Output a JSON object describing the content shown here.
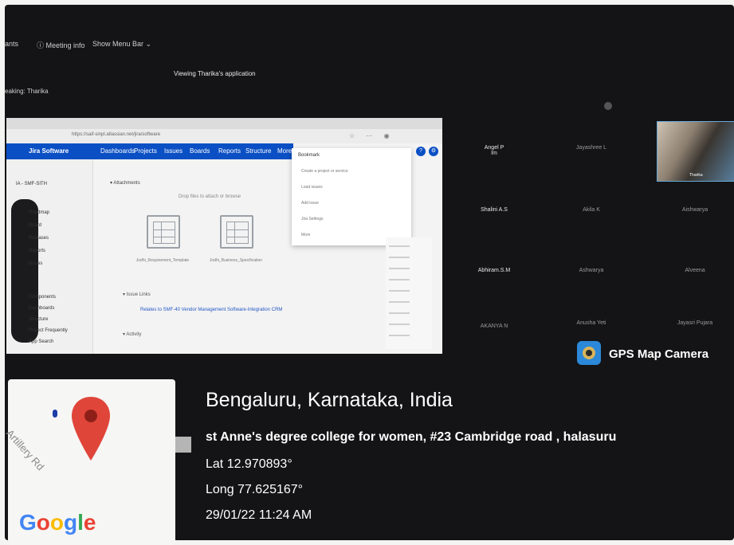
{
  "meeting": {
    "toolbar_left": "ants",
    "meeting_info": "Meeting info",
    "show_menu_bar": "Show Menu Bar",
    "viewing": "Viewing Tharika's application",
    "speaking": "eaking: Tharika"
  },
  "shared_screen": {
    "url": "https://saif-sinpl.atlassian.net/jira/software",
    "nav": [
      "Jira Software",
      "Dashboards",
      "Projects",
      "Issues",
      "Boards",
      "Reports",
      "Structure",
      "More"
    ],
    "project": "IA - SMF-SITH",
    "side_items": [
      "Roadmap",
      "Board",
      "Releases",
      "Reports",
      "Issues",
      "Components"
    ],
    "side_lower": [
      "Components",
      "Dashboards",
      "Structure",
      "Project Frequently",
      "App Search"
    ],
    "attachments_title": "Attachments",
    "drop_text": "Drop files to attach or browse",
    "file_captions": [
      "Jodhi_Requirement_Template",
      "Jodhi_Business_Specification"
    ],
    "issue_links_title": "Issue Links",
    "issue_link_row": "Relates to SMF-40 Vendor Management Software-Integration  CRM",
    "activity": "Activity",
    "dropdown_title": "Bookmark",
    "dropdown_rows": [
      "Create a project or service",
      "Load issues",
      "Add issue",
      "Jira Settings",
      "More"
    ]
  },
  "participants": [
    {
      "name": "Angel P",
      "sub": "Im"
    },
    {
      "name": "Jayashree L",
      "sub": ""
    },
    {
      "name": "Shalini A.S",
      "sub": ""
    },
    {
      "name": "Akila K",
      "sub": ""
    },
    {
      "name": "Aishwarya",
      "sub": ""
    },
    {
      "name": "Abhiram.S.M",
      "sub": ""
    },
    {
      "name": "Ashwarya",
      "sub": ""
    },
    {
      "name": "Alveena",
      "sub": ""
    },
    {
      "name": "AKANYA N",
      "sub": ""
    },
    {
      "name": "Anusha Yeti",
      "sub": ""
    },
    {
      "name": "Jayasri Pujara",
      "sub": ""
    }
  ],
  "video_label": "Tharika",
  "gps": {
    "app_name": "GPS Map Camera",
    "city": "Bengaluru, Karnataka, India",
    "address": "st Anne's degree college for women, #23 Cambridge road , halasuru",
    "lat": "Lat 12.970893°",
    "long": "Long 77.625167°",
    "datetime": "29/01/22 11:24 AM",
    "map_street": "Artillery Rd",
    "map_brand": [
      "G",
      "o",
      "o",
      "g",
      "l",
      "e"
    ],
    "brand_colors": [
      "#4285F4",
      "#EA4335",
      "#FBBC05",
      "#4285F4",
      "#34A853",
      "#EA4335"
    ]
  }
}
